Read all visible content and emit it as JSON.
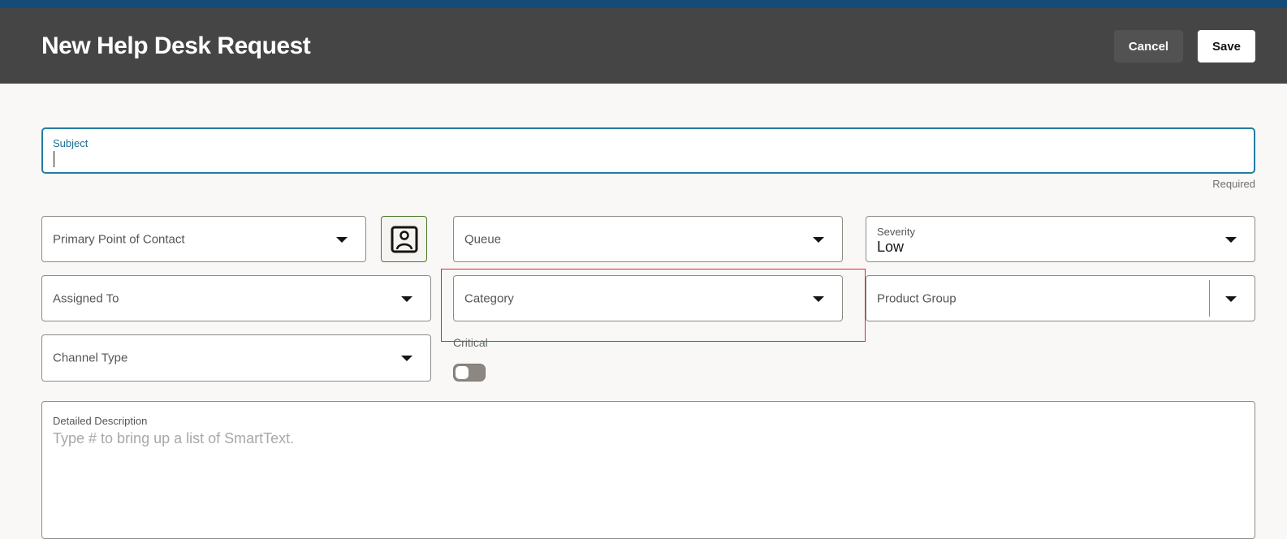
{
  "header": {
    "title": "New Help Desk Request",
    "cancel_label": "Cancel",
    "save_label": "Save"
  },
  "subject": {
    "label": "Subject",
    "value": "",
    "hint": "Required"
  },
  "fields": {
    "primary_contact": {
      "label": "Primary Point of Contact"
    },
    "queue": {
      "label": "Queue"
    },
    "severity": {
      "label": "Severity",
      "value": "Low"
    },
    "assigned_to": {
      "label": "Assigned To"
    },
    "category": {
      "label": "Category"
    },
    "product_group": {
      "label": "Product Group"
    },
    "channel_type": {
      "label": "Channel Type"
    },
    "critical": {
      "label": "Critical",
      "checked": false
    },
    "description": {
      "label": "Detailed Description",
      "placeholder": "Type # to bring up a list of SmartText."
    }
  },
  "colors": {
    "topbar": "#144b78",
    "header": "#454545",
    "focus": "#227ea2",
    "highlight": "#e0262a"
  }
}
